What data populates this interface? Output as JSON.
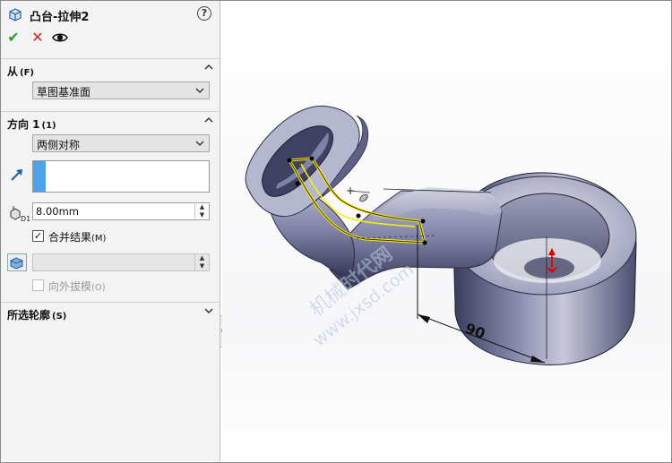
{
  "feature": {
    "title": "凸台-拉伸2",
    "help_icon": "?",
    "icon": "extrude-boss-icon"
  },
  "actions": {
    "ok_icon": "check-icon",
    "ok_glyph": "✔",
    "cancel_icon": "close-icon",
    "cancel_glyph": "✕",
    "preview_icon": "eye-icon"
  },
  "from": {
    "title": "从",
    "suffix": "(F)",
    "value": "草图基准面"
  },
  "direction1": {
    "title": "方向 1",
    "suffix": "(1)",
    "end_condition": "两侧对称",
    "depth": "8.00mm",
    "merge_checked": true,
    "merge_label": "合并结果",
    "merge_suffix": "(M)",
    "draft_value": "",
    "draft_outward_checked": false,
    "draft_outward_label": "向外拔模",
    "draft_outward_suffix": "(O)"
  },
  "selected_contours": {
    "title": "所选轮廓",
    "suffix": "(S)"
  },
  "viewport": {
    "dimension": "90",
    "watermark_line1": "机械时代网",
    "watermark_line2": "www.jxsd.com",
    "accent_color": "#ffee00",
    "model_color": "#6b6e8f"
  }
}
